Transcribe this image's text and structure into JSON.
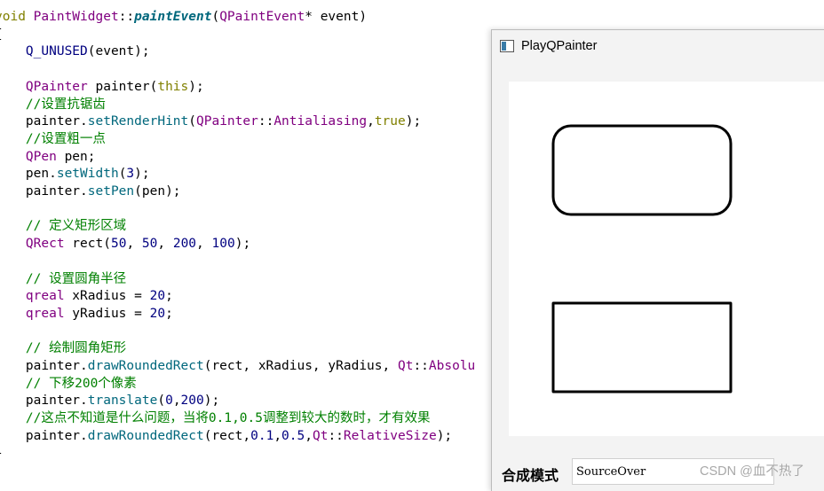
{
  "code_lines": [
    {
      "segments": [
        {
          "t": "void ",
          "c": "kw"
        },
        {
          "t": "PaintWidget",
          "c": "ty"
        },
        {
          "t": "::",
          "c": ""
        },
        {
          "t": "paintEvent",
          "c": "fi"
        },
        {
          "t": "(",
          "c": ""
        },
        {
          "t": "QPaintEvent",
          "c": "ty"
        },
        {
          "t": "* event)",
          "c": ""
        }
      ]
    },
    {
      "segments": [
        {
          "t": "{",
          "c": ""
        }
      ]
    },
    {
      "segments": [
        {
          "t": "    ",
          "c": ""
        },
        {
          "t": "Q_UNUSED",
          "c": "mac"
        },
        {
          "t": "(event);",
          "c": ""
        }
      ]
    },
    {
      "segments": []
    },
    {
      "segments": [
        {
          "t": "    ",
          "c": ""
        },
        {
          "t": "QPainter",
          "c": "ty"
        },
        {
          "t": " painter(",
          "c": ""
        },
        {
          "t": "this",
          "c": "kw"
        },
        {
          "t": ");",
          "c": ""
        }
      ]
    },
    {
      "segments": [
        {
          "t": "    ",
          "c": ""
        },
        {
          "t": "//设置抗锯齿",
          "c": "cm"
        }
      ]
    },
    {
      "segments": [
        {
          "t": "    painter.",
          "c": ""
        },
        {
          "t": "setRenderHint",
          "c": "fn"
        },
        {
          "t": "(",
          "c": ""
        },
        {
          "t": "QPainter",
          "c": "ty"
        },
        {
          "t": "::",
          "c": ""
        },
        {
          "t": "Antialiasing",
          "c": "ty"
        },
        {
          "t": ",",
          "c": ""
        },
        {
          "t": "true",
          "c": "kw"
        },
        {
          "t": ");",
          "c": ""
        }
      ]
    },
    {
      "segments": [
        {
          "t": "    ",
          "c": ""
        },
        {
          "t": "//设置粗一点",
          "c": "cm"
        }
      ]
    },
    {
      "segments": [
        {
          "t": "    ",
          "c": ""
        },
        {
          "t": "QPen",
          "c": "ty"
        },
        {
          "t": " pen;",
          "c": ""
        }
      ]
    },
    {
      "segments": [
        {
          "t": "    pen.",
          "c": ""
        },
        {
          "t": "setWidth",
          "c": "fn"
        },
        {
          "t": "(",
          "c": ""
        },
        {
          "t": "3",
          "c": "num"
        },
        {
          "t": ");",
          "c": ""
        }
      ]
    },
    {
      "segments": [
        {
          "t": "    painter.",
          "c": ""
        },
        {
          "t": "setPen",
          "c": "fn"
        },
        {
          "t": "(pen);",
          "c": ""
        }
      ]
    },
    {
      "segments": []
    },
    {
      "segments": [
        {
          "t": "    ",
          "c": ""
        },
        {
          "t": "// 定义矩形区域",
          "c": "cm"
        }
      ]
    },
    {
      "segments": [
        {
          "t": "    ",
          "c": ""
        },
        {
          "t": "QRect",
          "c": "ty"
        },
        {
          "t": " rect(",
          "c": ""
        },
        {
          "t": "50",
          "c": "num"
        },
        {
          "t": ", ",
          "c": ""
        },
        {
          "t": "50",
          "c": "num"
        },
        {
          "t": ", ",
          "c": ""
        },
        {
          "t": "200",
          "c": "num"
        },
        {
          "t": ", ",
          "c": ""
        },
        {
          "t": "100",
          "c": "num"
        },
        {
          "t": ");",
          "c": ""
        }
      ]
    },
    {
      "segments": []
    },
    {
      "segments": [
        {
          "t": "    ",
          "c": ""
        },
        {
          "t": "// 设置圆角半径",
          "c": "cm"
        }
      ]
    },
    {
      "segments": [
        {
          "t": "    ",
          "c": ""
        },
        {
          "t": "qreal",
          "c": "ty"
        },
        {
          "t": " xRadius = ",
          "c": ""
        },
        {
          "t": "20",
          "c": "num"
        },
        {
          "t": ";",
          "c": ""
        }
      ]
    },
    {
      "segments": [
        {
          "t": "    ",
          "c": ""
        },
        {
          "t": "qreal",
          "c": "ty"
        },
        {
          "t": " yRadius = ",
          "c": ""
        },
        {
          "t": "20",
          "c": "num"
        },
        {
          "t": ";",
          "c": ""
        }
      ]
    },
    {
      "segments": []
    },
    {
      "segments": [
        {
          "t": "    ",
          "c": ""
        },
        {
          "t": "// 绘制圆角矩形",
          "c": "cm"
        }
      ]
    },
    {
      "segments": [
        {
          "t": "    painter.",
          "c": ""
        },
        {
          "t": "drawRoundedRect",
          "c": "fn"
        },
        {
          "t": "(rect, xRadius, yRadius, ",
          "c": ""
        },
        {
          "t": "Qt",
          "c": "ty"
        },
        {
          "t": "::",
          "c": ""
        },
        {
          "t": "Absolu",
          "c": "ty"
        }
      ]
    },
    {
      "segments": [
        {
          "t": "    ",
          "c": ""
        },
        {
          "t": "// 下移200个像素",
          "c": "cm"
        }
      ]
    },
    {
      "segments": [
        {
          "t": "    painter.",
          "c": ""
        },
        {
          "t": "translate",
          "c": "fn"
        },
        {
          "t": "(",
          "c": ""
        },
        {
          "t": "0",
          "c": "num"
        },
        {
          "t": ",",
          "c": ""
        },
        {
          "t": "200",
          "c": "num"
        },
        {
          "t": ");",
          "c": ""
        }
      ]
    },
    {
      "segments": [
        {
          "t": "    ",
          "c": ""
        },
        {
          "t": "//这点不知道是什么问题，当将0.1,0.5调整到较大的数时，才有效果",
          "c": "cm"
        }
      ]
    },
    {
      "segments": [
        {
          "t": "    painter.",
          "c": ""
        },
        {
          "t": "drawRoundedRect",
          "c": "fn"
        },
        {
          "t": "(rect,",
          "c": ""
        },
        {
          "t": "0.1",
          "c": "num"
        },
        {
          "t": ",",
          "c": ""
        },
        {
          "t": "0.5",
          "c": "num"
        },
        {
          "t": ",",
          "c": ""
        },
        {
          "t": "Qt",
          "c": "ty"
        },
        {
          "t": "::",
          "c": ""
        },
        {
          "t": "RelativeSize",
          "c": "ty"
        },
        {
          "t": ");",
          "c": ""
        }
      ]
    },
    {
      "segments": [
        {
          "t": "}",
          "c": ""
        }
      ]
    }
  ],
  "window": {
    "title": "PlayQPainter",
    "mode_label": "合成模式",
    "mode_value": "SourceOver"
  },
  "watermark": "CSDN @血不热了"
}
